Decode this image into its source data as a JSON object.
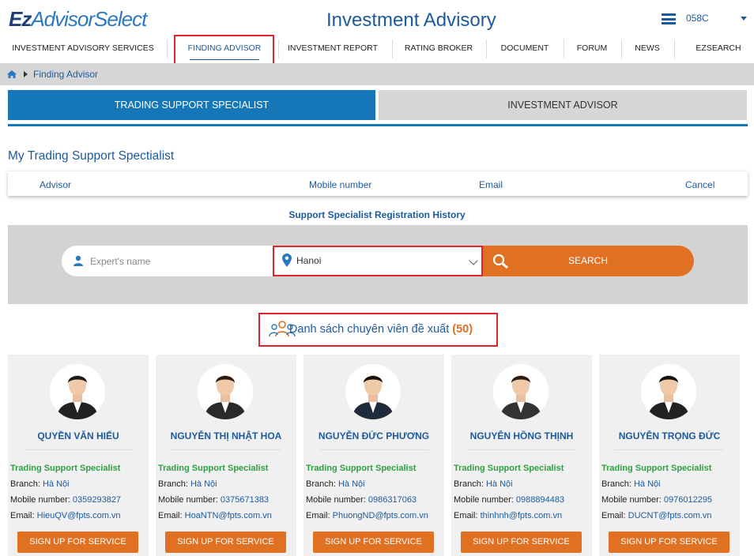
{
  "header": {
    "logo_ez": "Ez",
    "logo_rest": "AdvisorSelect",
    "app_title": "Investment Advisory",
    "account": "058C"
  },
  "nav": {
    "items": [
      "INVESTMENT ADVISORY SERVICES",
      "FINDING ADVISOR",
      "INVESTMENT REPORT",
      "RATING BROKER",
      "DOCUMENT",
      "FORUM",
      "NEWS",
      "EZSEARCH"
    ],
    "active": "FINDING ADVISOR"
  },
  "breadcrumb": {
    "current": "Finding Advisor"
  },
  "tabs": {
    "active_label": "TRADING SUPPORT SPECIALIST",
    "other_label": "INVESTMENT ADVISOR"
  },
  "my_specialist": {
    "title": "My Trading Support Spectialist",
    "columns": [
      "Advisor",
      "Mobile number",
      "Email",
      "Cancel"
    ],
    "history_link": "Support Specialist Registration History"
  },
  "search": {
    "name_placeholder": "Expert's name",
    "location_value": "Hanoi",
    "button_label": "SEARCH"
  },
  "list": {
    "heading": "Danh sách chuyên viên đề xuất",
    "count": "(50)"
  },
  "labels": {
    "branch": "Branch: ",
    "mobile": "Mobile number: ",
    "email": "Email: ",
    "signup": "SIGN UP FOR SERVICE"
  },
  "advisors": [
    {
      "name": "QUYỀN VĂN HIẾU",
      "role": "Trading Support Specialist",
      "branch": "Hà Nội",
      "mobile": "0359293827",
      "email": "HieuQV@fpts.com.vn"
    },
    {
      "name": "NGUYỄN THỊ NHẬT HOA",
      "role": "Trading Support Specialist",
      "branch": "Hà Nội",
      "mobile": "0375671383",
      "email": "HoaNTN@fpts.com.vn"
    },
    {
      "name": "NGUYỄN ĐỨC PHƯƠNG",
      "role": "Trading Support Specialist",
      "branch": "Hà Nội",
      "mobile": "0986317063",
      "email": "PhuongND@fpts.com.vn"
    },
    {
      "name": "NGUYỄN HỒNG THỊNH",
      "role": "Trading Support Specialist",
      "branch": "Hà Nội",
      "mobile": "0988894483",
      "email": "thinhnh@fpts.com.vn"
    },
    {
      "name": "NGUYỄN TRỌNG ĐỨC",
      "role": "Trading Support Specialist",
      "branch": "Hà Nội",
      "mobile": "0976012295",
      "email": "DUCNT@fpts.com.vn"
    }
  ],
  "colors": {
    "brand_blue": "#1677b8",
    "accent_orange": "#e07022",
    "highlight_red": "#e0252b",
    "role_green": "#2ea043"
  }
}
